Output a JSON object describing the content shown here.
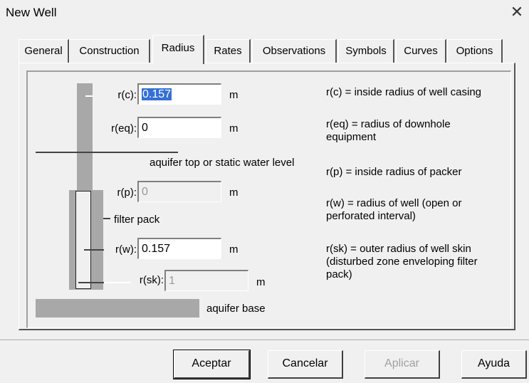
{
  "window": {
    "title": "New Well"
  },
  "tabs": [
    {
      "label": "General"
    },
    {
      "label": "Construction"
    },
    {
      "label": "Radius"
    },
    {
      "label": "Rates"
    },
    {
      "label": "Observations"
    },
    {
      "label": "Symbols"
    },
    {
      "label": "Curves"
    },
    {
      "label": "Options"
    }
  ],
  "active_tab": "Radius",
  "fields": {
    "rc": {
      "label": "r(c):",
      "value": "0.157",
      "unit": "m",
      "enabled": true
    },
    "req": {
      "label": "r(eq):",
      "value": "0",
      "unit": "m",
      "enabled": true
    },
    "rp": {
      "label": "r(p):",
      "value": "0",
      "unit": "m",
      "enabled": false
    },
    "rw": {
      "label": "r(w):",
      "value": "0.157",
      "unit": "m",
      "enabled": true
    },
    "rsk": {
      "label": "r(sk):",
      "value": "1",
      "unit": "m",
      "enabled": false
    }
  },
  "diagram": {
    "aquifer_top_label": "aquifer top or static water level",
    "filter_pack_label": "filter pack",
    "aquifer_base_label": "aquifer base"
  },
  "descriptions": {
    "rc": "r(c) = inside radius of well casing",
    "req": "r(eq) = radius of downhole equipment",
    "rp": "r(p) = inside radius of packer",
    "rw": "r(w) = radius of well (open or perforated interval)",
    "rsk": "r(sk) = outer radius of well skin (disturbed zone enveloping filter pack)"
  },
  "buttons": {
    "ok": "Aceptar",
    "cancel": "Cancelar",
    "apply": "Aplicar",
    "help": "Ayuda"
  }
}
